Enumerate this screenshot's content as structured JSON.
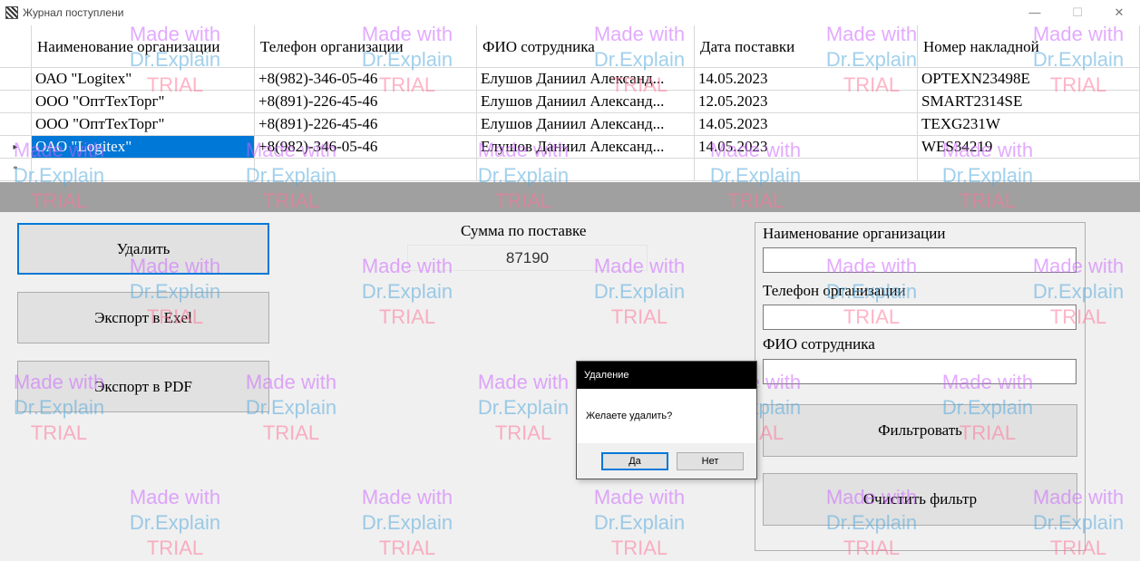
{
  "window": {
    "title": "Журнал поступлени"
  },
  "grid": {
    "columns": [
      "Наименование организации",
      "Телефон организации",
      "ФИО сотрудника",
      "Дата поставки",
      "Номер накладной"
    ],
    "rows": [
      [
        "ОАО \"Logitex\"",
        "+8(982)-346-05-46",
        "Елушов Даниил Александ...",
        "14.05.2023",
        "OPTEXN23498E"
      ],
      [
        "ООО \"ОптТехТорг\"",
        "+8(891)-226-45-46",
        "Елушов Даниил Александ...",
        "12.05.2023",
        "SMART2314SE"
      ],
      [
        "ООО \"ОптТехТорг\"",
        "+8(891)-226-45-46",
        "Елушов Даниил Александ...",
        "14.05.2023",
        "TEXG231W"
      ],
      [
        "ОАО \"Logitex\"",
        "+8(982)-346-05-46",
        "Елушов Даниил Александ...",
        "14.05.2023",
        "WES34219"
      ]
    ],
    "selected_row_indicator": "▸",
    "new_row_indicator": "*"
  },
  "buttons": {
    "delete": "Удалить",
    "export_excel": "Экспорт в Exel",
    "export_pdf": "Экспорт в PDF",
    "filter": "Фильтровать",
    "clear_filter": "Очистить фильтр"
  },
  "sum": {
    "label": "Сумма по поставке",
    "value": "87190"
  },
  "filter": {
    "org_label": "Наименование организации",
    "phone_label": "Телефон организации",
    "employee_label": "ФИО сотрудника",
    "org_value": "",
    "phone_value": "",
    "employee_value": ""
  },
  "dialog": {
    "title": "Удаление",
    "message": "Желаете удалить?",
    "yes": "Да",
    "no": "Нет"
  },
  "watermark": {
    "line1": "Made with",
    "line2": "Dr.Explain",
    "line3": "TRIAL"
  },
  "colors": {
    "selection": "#0078d7",
    "grid_band": "#a0a0a0",
    "dialog_title_bg": "#000000"
  }
}
